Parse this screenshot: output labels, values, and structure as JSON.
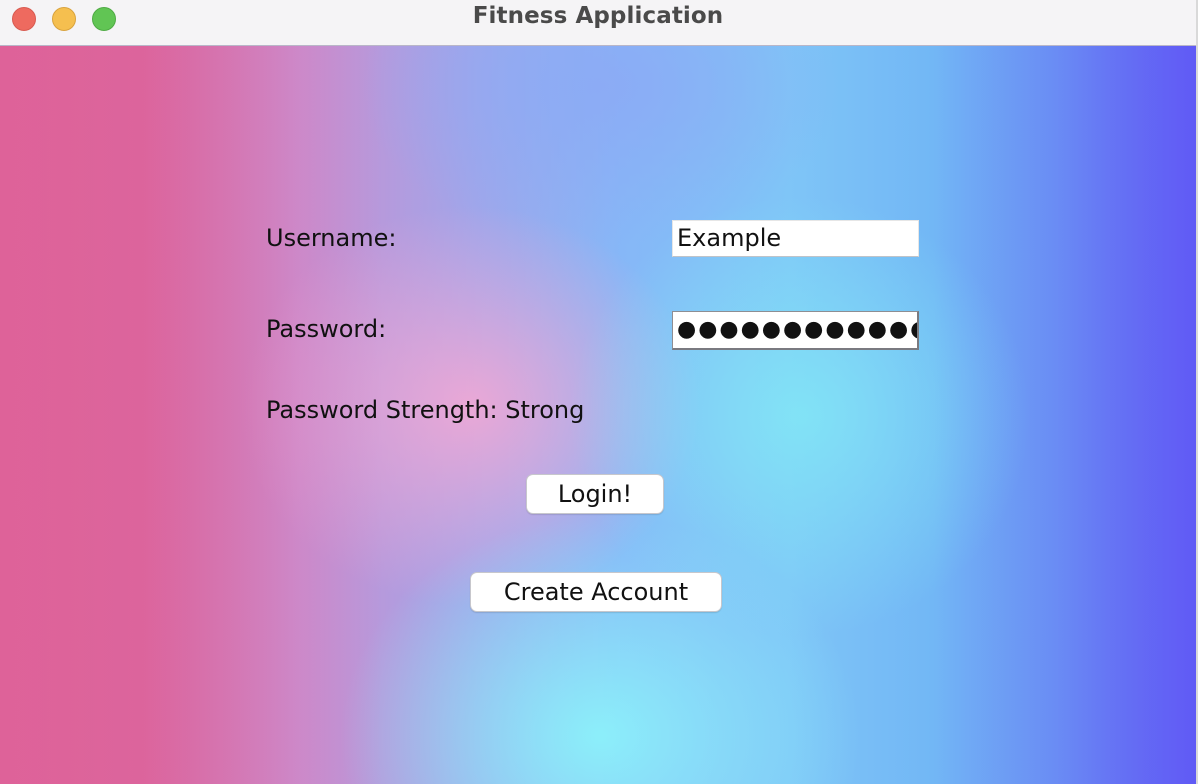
{
  "window": {
    "title": "Fitness Application"
  },
  "form": {
    "username_label": "Username:",
    "username_value": "Example",
    "password_label": "Password:",
    "password_masked": "●●●●●●●●●●●●",
    "strength_text": "Password Strength: Strong",
    "login_label": "Login!",
    "create_account_label": "Create Account"
  },
  "colors": {
    "traffic_close": "#ee6a5f",
    "traffic_minimize": "#f5bf4f",
    "traffic_maximize": "#61c554",
    "background_left": "#e8609a",
    "background_center": "#8cf2fa",
    "background_right": "#5a50f5"
  }
}
